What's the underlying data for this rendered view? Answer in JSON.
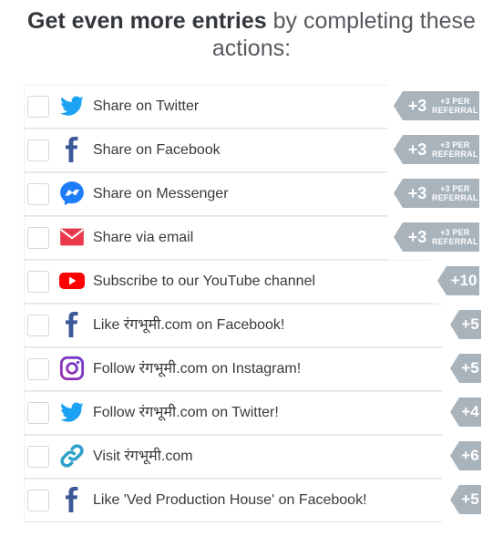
{
  "heading": {
    "bold": "Get even more entries",
    "rest": " by completing these",
    "line2": "actions:"
  },
  "actions": [
    {
      "label": "Share on Twitter",
      "icon": "twitter-icon",
      "points": "+3",
      "sub1": "+3 PER",
      "sub2": "REFERRAL"
    },
    {
      "label": "Share on Facebook",
      "icon": "facebook-icon",
      "points": "+3",
      "sub1": "+3 PER",
      "sub2": "REFERRAL"
    },
    {
      "label": "Share on Messenger",
      "icon": "messenger-icon",
      "points": "+3",
      "sub1": "+3 PER",
      "sub2": "REFERRAL"
    },
    {
      "label": "Share via email",
      "icon": "email-icon",
      "points": "+3",
      "sub1": "+3 PER",
      "sub2": "REFERRAL"
    },
    {
      "label": "Subscribe to our YouTube channel",
      "icon": "youtube-icon",
      "points": "+10"
    },
    {
      "label": "Like रंगभूमी.com on Facebook!",
      "icon": "facebook-icon",
      "points": "+5"
    },
    {
      "label": "Follow रंगभूमी.com on Instagram!",
      "icon": "instagram-icon",
      "points": "+5"
    },
    {
      "label": "Follow रंगभूमी.com on Twitter!",
      "icon": "twitter-icon",
      "points": "+4"
    },
    {
      "label": "Visit रंगभूमी.com",
      "icon": "link-icon",
      "points": "+6"
    },
    {
      "label": "Like 'Ved Production House' on Facebook!",
      "icon": "facebook-icon",
      "points": "+5"
    }
  ],
  "colors": {
    "twitter": "#1da1f2",
    "facebook": "#3b5998",
    "messenger": "#0084ff",
    "email": "#e83a4c",
    "youtube": "#ff0000",
    "instagram": "#8a3ab9",
    "link": "#2fa0c8",
    "badge": "#a9b3bb"
  }
}
